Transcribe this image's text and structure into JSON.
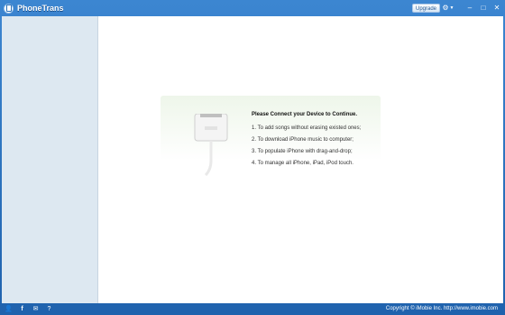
{
  "window": {
    "title": "PhoneTrans",
    "upgrade_label": "Upgrade"
  },
  "icons": {
    "settings": "gear-icon",
    "minimize": "minimize-icon",
    "maximize": "maximize-icon",
    "close": "close-icon",
    "statusbar": [
      "user-icon",
      "facebook-icon",
      "email-icon",
      "help-icon"
    ]
  },
  "connect_panel": {
    "heading": "Please Connect your Device to Continue.",
    "steps": [
      "1. To add songs without erasing existed ones;",
      "2. To download iPhone music to computer;",
      "3. To populate iPhone with drag-and-drop;",
      "4. To manage all iPhone, iPad, iPod touch."
    ]
  },
  "statusbar": {
    "copyright": "Copyright © iMobie Inc. http://www.imobie.com"
  },
  "colors": {
    "titlebar": "#2a6fb8",
    "sidebar": "#dde8f1",
    "panel": "#eef6ea"
  }
}
